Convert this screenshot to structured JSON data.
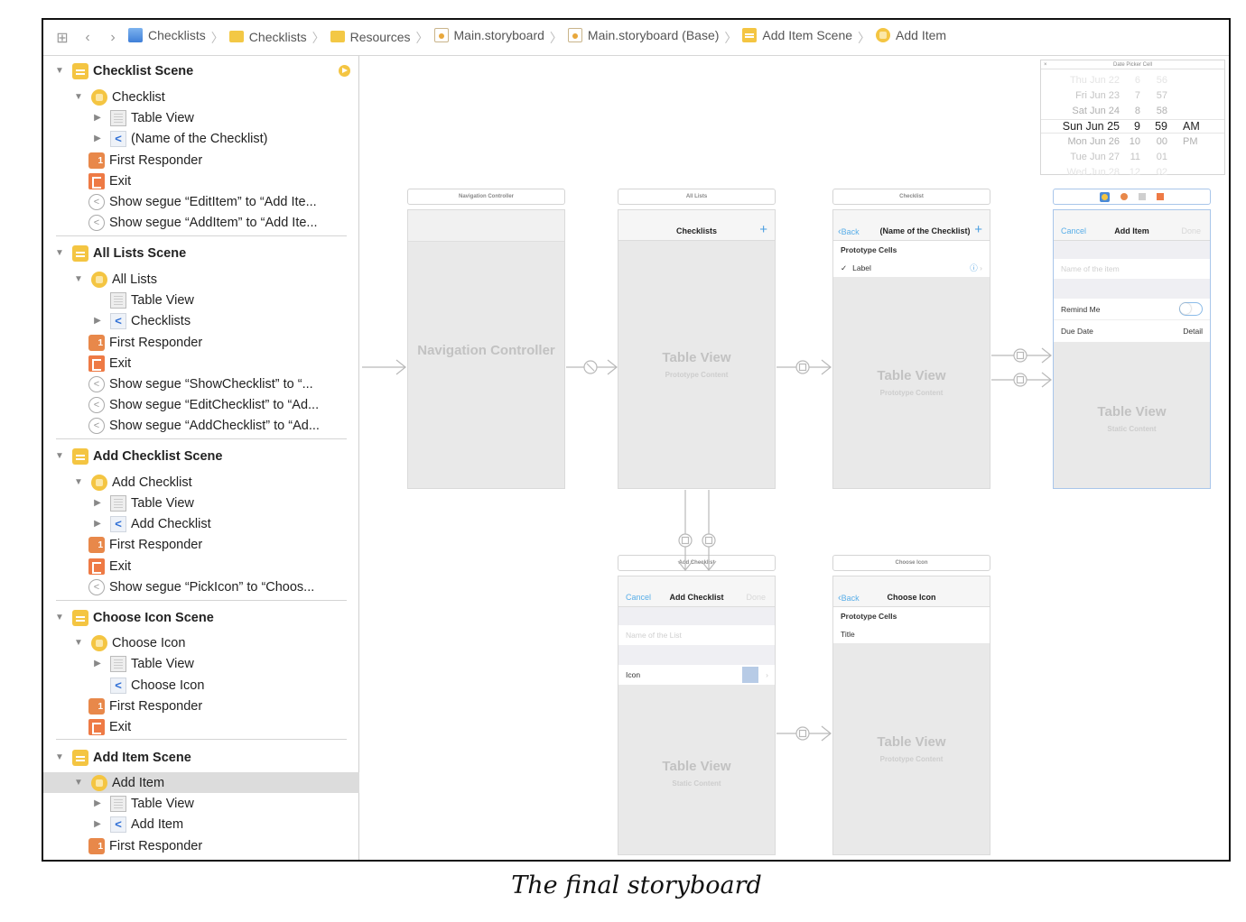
{
  "jumpbar": {
    "grid_icon": "grid-icon",
    "back_icon": "chevron-left-icon",
    "forward_icon": "chevron-right-icon",
    "crumbs": [
      {
        "label": "Checklists",
        "icon": "app-project-icon"
      },
      {
        "label": "Checklists",
        "icon": "folder-icon"
      },
      {
        "label": "Resources",
        "icon": "folder-icon"
      },
      {
        "label": "Main.storyboard",
        "icon": "storyboard-file-icon"
      },
      {
        "label": "Main.storyboard (Base)",
        "icon": "storyboard-file-icon"
      },
      {
        "label": "Add Item Scene",
        "icon": "scene-icon"
      },
      {
        "label": "Add Item",
        "icon": "view-controller-icon"
      }
    ]
  },
  "outline": {
    "rows": [
      {
        "label": "Checklist Scene",
        "level": 0,
        "type": "scene",
        "expanded": true
      },
      {
        "label": "Checklist",
        "level": 1,
        "type": "vc",
        "expanded": true
      },
      {
        "label": "Table View",
        "level": 2,
        "type": "table",
        "expanded": false
      },
      {
        "label": "(Name of the Checklist)",
        "level": 2,
        "type": "navitem",
        "expanded": false
      },
      {
        "label": "First Responder",
        "level": 1,
        "type": "responder"
      },
      {
        "label": "Exit",
        "level": 1,
        "type": "exit"
      },
      {
        "label": "Show segue “EditItem” to “Add Ite...",
        "level": 1,
        "type": "segue"
      },
      {
        "label": "Show segue “AddItem” to “Add Ite...",
        "level": 1,
        "type": "segue"
      },
      {
        "label": "All Lists Scene",
        "level": 0,
        "type": "scene",
        "expanded": true
      },
      {
        "label": "All Lists",
        "level": 1,
        "type": "vc",
        "expanded": true
      },
      {
        "label": "Table View",
        "level": 2,
        "type": "table"
      },
      {
        "label": "Checklists",
        "level": 2,
        "type": "navitem",
        "expanded": false
      },
      {
        "label": "First Responder",
        "level": 1,
        "type": "responder"
      },
      {
        "label": "Exit",
        "level": 1,
        "type": "exit"
      },
      {
        "label": "Show segue “ShowChecklist” to “...",
        "level": 1,
        "type": "segue"
      },
      {
        "label": "Show segue “EditChecklist” to “Ad...",
        "level": 1,
        "type": "segue"
      },
      {
        "label": "Show segue “AddChecklist” to “Ad...",
        "level": 1,
        "type": "segue"
      },
      {
        "label": "Add Checklist Scene",
        "level": 0,
        "type": "scene",
        "expanded": true
      },
      {
        "label": "Add Checklist",
        "level": 1,
        "type": "vc",
        "expanded": true
      },
      {
        "label": "Table View",
        "level": 2,
        "type": "table",
        "expanded": false
      },
      {
        "label": "Add Checklist",
        "level": 2,
        "type": "navitem",
        "expanded": false
      },
      {
        "label": "First Responder",
        "level": 1,
        "type": "responder"
      },
      {
        "label": "Exit",
        "level": 1,
        "type": "exit"
      },
      {
        "label": "Show segue “PickIcon” to “Choos...",
        "level": 1,
        "type": "segue"
      },
      {
        "label": "Choose Icon Scene",
        "level": 0,
        "type": "scene",
        "expanded": true
      },
      {
        "label": "Choose Icon",
        "level": 1,
        "type": "vc",
        "expanded": true
      },
      {
        "label": "Table View",
        "level": 2,
        "type": "table",
        "expanded": false
      },
      {
        "label": "Choose Icon",
        "level": 2,
        "type": "navitem"
      },
      {
        "label": "First Responder",
        "level": 1,
        "type": "responder"
      },
      {
        "label": "Exit",
        "level": 1,
        "type": "exit"
      },
      {
        "label": "Add Item Scene",
        "level": 0,
        "type": "scene",
        "expanded": true
      },
      {
        "label": "Add Item",
        "level": 1,
        "type": "vc",
        "expanded": true,
        "selected": true
      },
      {
        "label": "Table View",
        "level": 2,
        "type": "table",
        "expanded": false
      },
      {
        "label": "Add Item",
        "level": 2,
        "type": "navitem",
        "expanded": false
      },
      {
        "label": "First Responder",
        "level": 1,
        "type": "responder"
      }
    ]
  },
  "canvas": {
    "nav_controller": {
      "dock_label": "Navigation Controller",
      "placeholder": "Navigation Controller"
    },
    "all_lists": {
      "dock_label": "All Lists",
      "nav_title": "Checklists",
      "add_symbol": "+",
      "placeholder": "Table View",
      "placeholder_sub": "Prototype Content"
    },
    "checklist": {
      "dock_label": "Checklist",
      "back_label": "Back",
      "nav_title": "(Name of the Checklist)",
      "add_symbol": "+",
      "section_header": "Prototype Cells",
      "cell_check": "✓",
      "cell_label": "Label",
      "placeholder": "Table View",
      "placeholder_sub": "Prototype Content"
    },
    "add_item": {
      "cancel_label": "Cancel",
      "nav_title": "Add Item",
      "done_label": "Done",
      "name_placeholder": "Name of the item",
      "remind_label": "Remind Me",
      "remind_on": false,
      "due_label": "Due Date",
      "due_detail": "Detail",
      "placeholder": "Table View",
      "placeholder_sub": "Static Content"
    },
    "add_checklist": {
      "dock_label": "Add Checklist",
      "cancel_label": "Cancel",
      "nav_title": "Add Checklist",
      "done_label": "Done",
      "name_placeholder": "Name of the List",
      "icon_label": "Icon",
      "placeholder": "Table View",
      "placeholder_sub": "Static Content"
    },
    "choose_icon": {
      "dock_label": "Choose Icon",
      "back_label": "Back",
      "nav_title": "Choose Icon",
      "section_header": "Prototype Cells",
      "cell_label": "Title",
      "placeholder": "Table View",
      "placeholder_sub": "Prototype Content"
    },
    "date_picker": {
      "title": "Date Picker Cell",
      "close": "×",
      "rows": [
        {
          "d": "Thu Jun 22",
          "h": "6",
          "m": "56",
          "ap": ""
        },
        {
          "d": "Fri Jun 23",
          "h": "7",
          "m": "57",
          "ap": ""
        },
        {
          "d": "Sat Jun 24",
          "h": "8",
          "m": "58",
          "ap": ""
        },
        {
          "d": "Sun Jun 25",
          "h": "9",
          "m": "59",
          "ap": "AM"
        },
        {
          "d": "Mon Jun 26",
          "h": "10",
          "m": "00",
          "ap": "PM"
        },
        {
          "d": "Tue Jun 27",
          "h": "11",
          "m": "01",
          "ap": ""
        },
        {
          "d": "Wed Jun 28",
          "h": "12",
          "m": "02",
          "ap": ""
        }
      ],
      "selected_index": 3
    }
  },
  "caption": "The final storyboard"
}
